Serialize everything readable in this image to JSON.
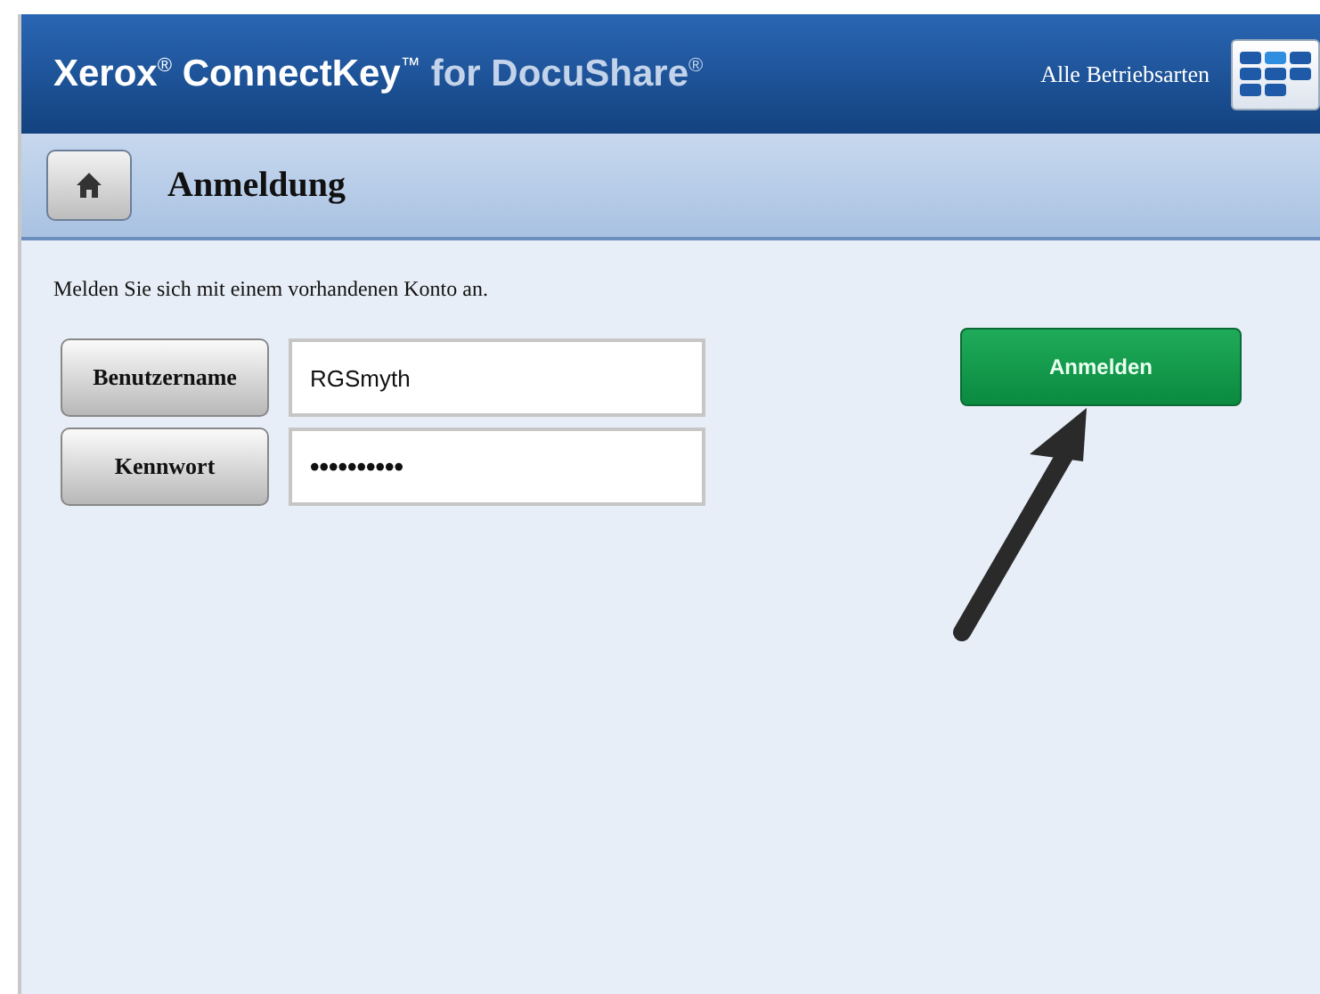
{
  "header": {
    "brand": "Xerox$^{®}$ ConnectKey$^{™}$",
    "product": "for DocuShare$^{®}$",
    "mode_label": "Alle Betriebsarten"
  },
  "subheader": {
    "title": "Anmeldung"
  },
  "intro": "Melden Sie sich mit einem vorhandenen Konto an.",
  "fields": [
    {
      "label": "Benutzername",
      "value": "RGSmyth",
      "kind": "text"
    },
    {
      "label": "Kennwort",
      "value": "••••••••••",
      "kind": "password"
    }
  ],
  "submit_button": "Anmelden"
}
